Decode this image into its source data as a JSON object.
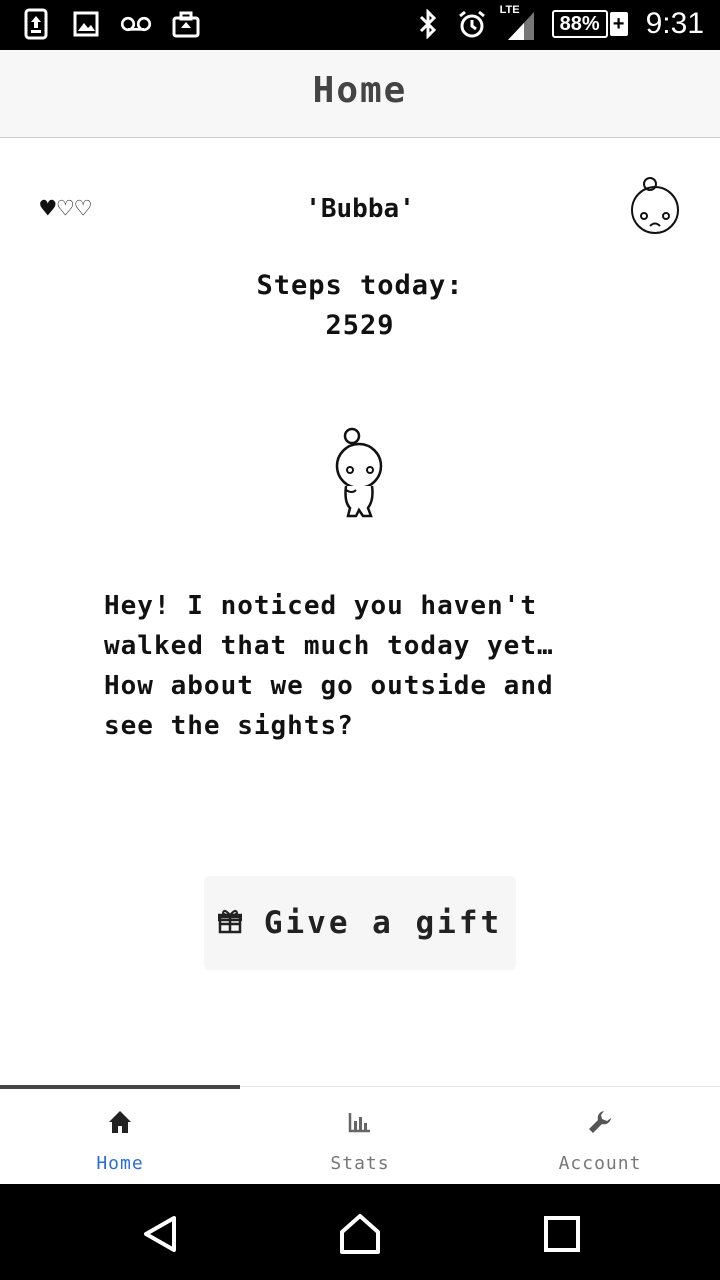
{
  "status_bar": {
    "icons_left": [
      "upload-icon",
      "image-icon",
      "voicemail-icon",
      "briefcase-icon"
    ],
    "icons_right": [
      "bluetooth-icon",
      "alarm-icon",
      "signal-icon"
    ],
    "network": "LTE",
    "battery": "88%",
    "battery_charging": "+",
    "time": "9:31"
  },
  "header": {
    "title": "Home"
  },
  "pet": {
    "hearts": [
      "♥",
      "♡",
      "♡"
    ],
    "name": "'Bubba'",
    "mood_icon": "sad-face-icon",
    "steps_label": "Steps today:",
    "steps_value": "2529",
    "message": "Hey! I noticed you haven't\nwalked that much today yet…\nHow about we go outside and\nsee the sights?"
  },
  "gift_button": {
    "icon": "gift-icon",
    "label": "Give a gift"
  },
  "bottom_nav": {
    "items": [
      {
        "label": "Home",
        "icon": "home-icon",
        "active": true
      },
      {
        "label": "Stats",
        "icon": "bar-chart-icon",
        "active": false
      },
      {
        "label": "Account",
        "icon": "wrench-icon",
        "active": false
      }
    ]
  },
  "system_nav": {
    "buttons": [
      "back-icon",
      "home-circle-icon",
      "recents-icon"
    ]
  },
  "colors": {
    "accent": "#2a6fd6",
    "status_bar": "#000000",
    "header_bg": "#f7f7f7"
  }
}
